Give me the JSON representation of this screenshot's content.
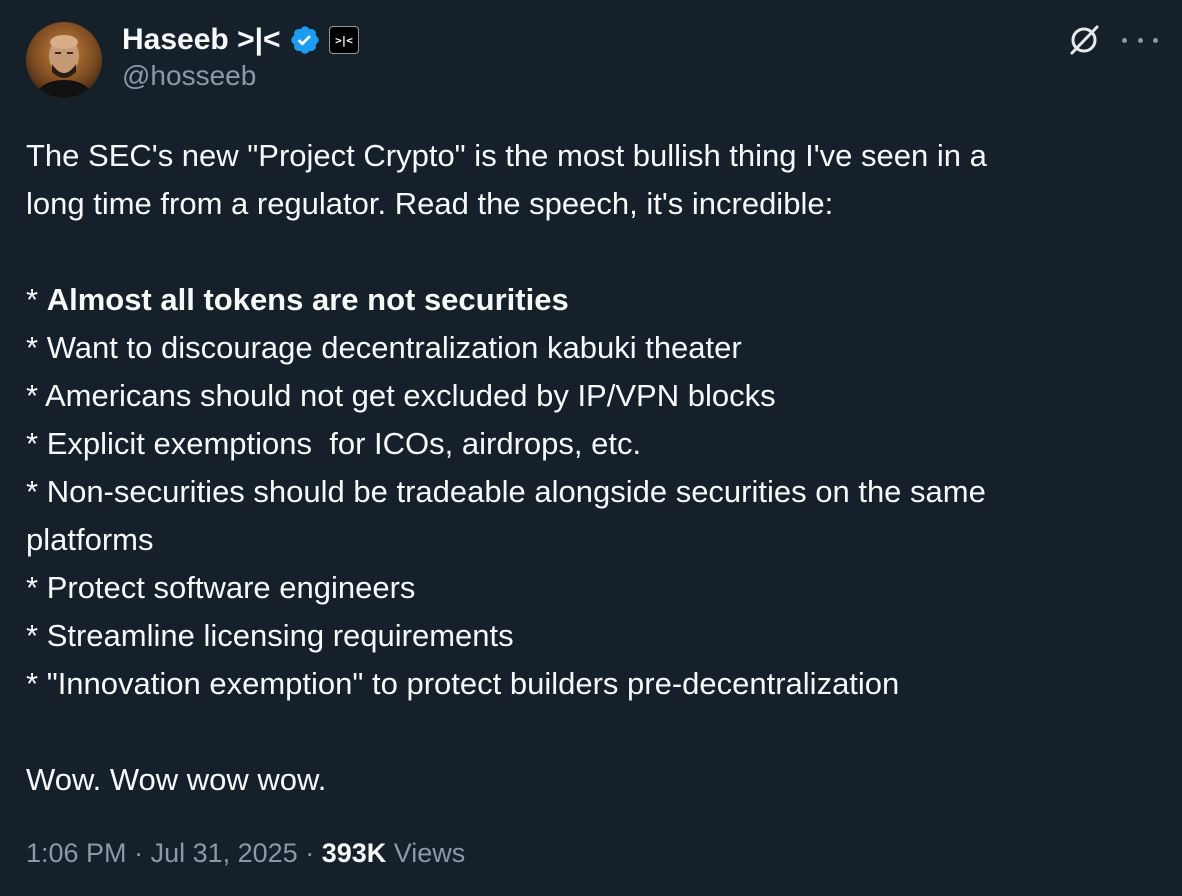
{
  "author": {
    "display_name": "Haseeb >|<",
    "handle": "@hosseeb",
    "affiliation_badge": ">|<",
    "verified_color": "#1d9bf0"
  },
  "icons": {
    "verified": "verified-badge-icon",
    "grok": "grok-icon",
    "more": "more-options-icon"
  },
  "tweet": {
    "intro_line1": "The SEC's new \"Project Crypto\" is the most bullish thing I've seen in a",
    "intro_line2": "long time from a regulator. Read the speech, it's incredible:",
    "bullets": [
      {
        "prefix": "* ",
        "text": "Almost all tokens are not securities"
      },
      {
        "prefix": "* ",
        "text": "Want to discourage decentralization kabuki theater"
      },
      {
        "prefix": "* ",
        "text": "Americans should not get excluded by IP/VPN blocks"
      },
      {
        "prefix": "* ",
        "text": "Explicit exemptions  for ICOs, airdrops, etc."
      },
      {
        "prefix": "* ",
        "text": "Non-securities should be tradeable alongside securities on the same"
      },
      {
        "prefix": "",
        "text": "platforms"
      },
      {
        "prefix": "* ",
        "text": "Protect software engineers"
      },
      {
        "prefix": "* ",
        "text": "Streamline licensing requirements"
      },
      {
        "prefix": "* ",
        "text": "\"Innovation exemption\" to protect builders pre-decentralization"
      }
    ],
    "outro": "Wow. Wow wow wow."
  },
  "meta": {
    "time": "1:06 PM",
    "separator1": " · ",
    "date": "Jul 31, 2025",
    "separator2": " · ",
    "views_count": "393K",
    "views_label": " Views"
  }
}
